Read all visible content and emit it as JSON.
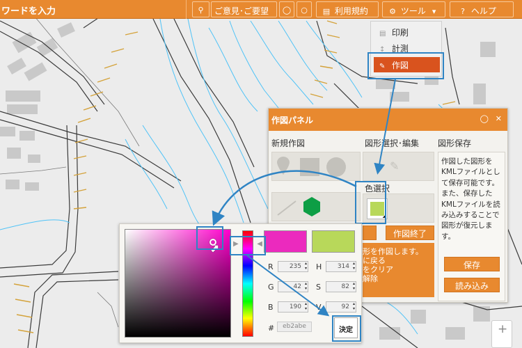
{
  "topbar": {
    "search_placeholder": "ワードを入力",
    "feedback_label": "ご意見･ご要望",
    "terms_label": "利用規約",
    "tools_label": "ツール",
    "help_label": "ヘルプ"
  },
  "tool_menu": {
    "items": [
      {
        "label": "印刷",
        "icon": "print-icon"
      },
      {
        "label": "計測",
        "icon": "measure-icon"
      },
      {
        "label": "作図",
        "icon": "pencil-icon",
        "active": true
      }
    ]
  },
  "drawing_panel": {
    "title": "作図パネル",
    "new_drawing": "新規作図",
    "select_edit": "図形選択･編集",
    "save_shapes": "図形保存",
    "color_select": "色選択",
    "finish_label": "作図終了",
    "save_description": "作図した図形をKMLファイルとして保存可能です。また、保存したKMLファイルを読み込みすることで図形が復元します。",
    "instructions": [
      "形を作図します。",
      "に戻る",
      "をクリア",
      "解除"
    ],
    "save_button": "保存",
    "load_button": "読み込み"
  },
  "color_picker": {
    "r": "235",
    "g": "42",
    "b": "190",
    "h": "314",
    "s": "82",
    "v": "92",
    "hex_label": "#",
    "hex": "eb2abe",
    "decide_label": "決定",
    "new_color": "#eb2abe",
    "old_color": "#b8d85a"
  },
  "colors": {
    "accent": "#e8892f",
    "active_menu": "#d9531e",
    "callout": "#2f84c4",
    "shape_green": "#0d9e45"
  },
  "zoom": {
    "plus": "+"
  }
}
